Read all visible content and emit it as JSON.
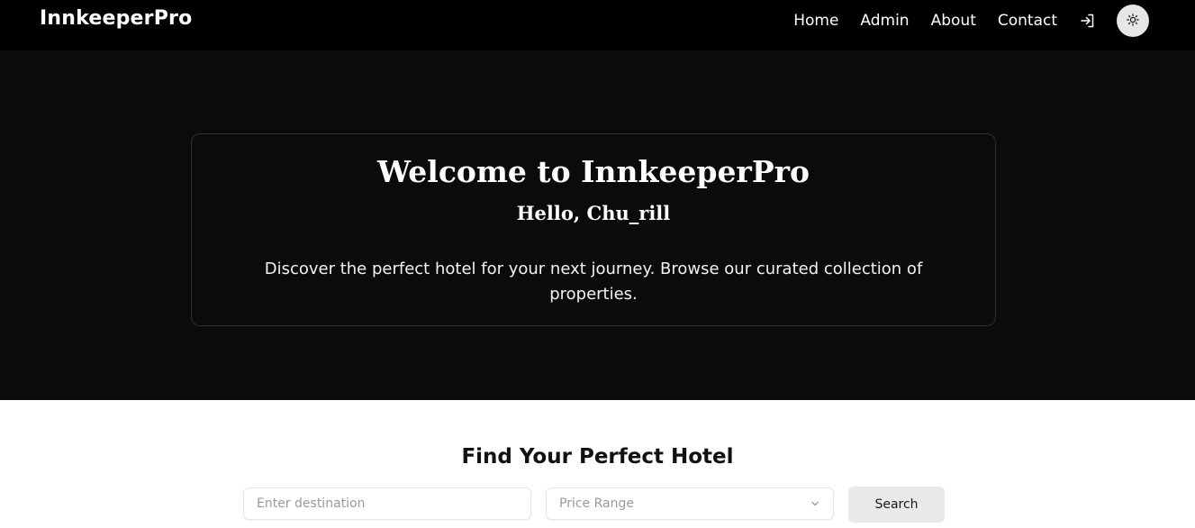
{
  "colors": {
    "navbar_bg": "#000000",
    "hero_bg": "#0b0b0b",
    "card_border": "#2e2e2e",
    "theme_toggle_bg": "#e6e6e6",
    "search_button_bg": "#e9e9e9"
  },
  "navbar": {
    "brand": "InnkeeperPro",
    "links": [
      "Home",
      "Admin",
      "About",
      "Contact"
    ],
    "login_icon": "login-icon",
    "theme_toggle_icon": "sun-icon"
  },
  "hero": {
    "title": "Welcome to InnkeeperPro",
    "greeting": "Hello, Chu_rill",
    "description": "Discover the perfect hotel for your next journey. Browse our curated collection of properties."
  },
  "search": {
    "title": "Find Your Perfect Hotel",
    "destination_placeholder": "Enter destination",
    "destination_value": "",
    "price_range_label": "Price Range",
    "dropdown_icon": "chevron-down-icon",
    "button_label": "Search"
  }
}
